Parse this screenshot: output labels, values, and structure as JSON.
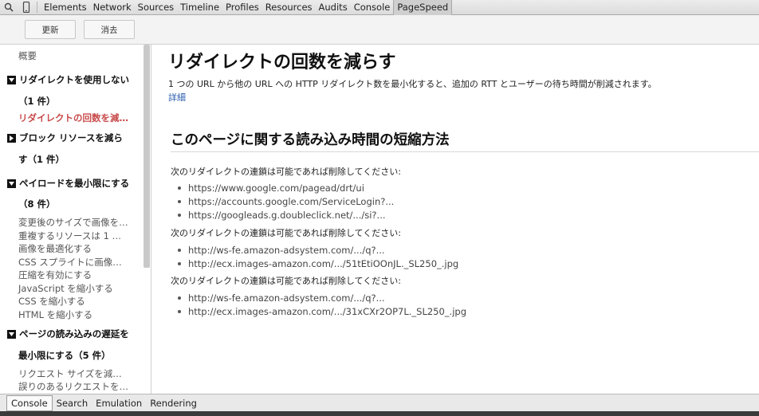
{
  "toolbar": {
    "tabs": [
      "Elements",
      "Network",
      "Sources",
      "Timeline",
      "Profiles",
      "Resources",
      "Audits",
      "Console",
      "PageSpeed"
    ]
  },
  "actions": {
    "refresh": "更新",
    "clear": "消去"
  },
  "sidebar": {
    "overview": "概要",
    "sections": [
      {
        "line1": "リダイレクトを使用しない",
        "line2": "（1 件）",
        "items": [
          "リダイレクトの回数を減…"
        ]
      },
      {
        "line1": "ブロック リソースを減ら",
        "line2": "す（1 件）",
        "items": []
      },
      {
        "line1": "ペイロードを最小限にする",
        "line2": "（8 件）",
        "items": [
          "変更後のサイズで画像を…",
          "重複するリソースは 1 …",
          "画像を最適化する",
          "CSS スプライトに画像…",
          "圧縮を有効にする",
          "JavaScript を縮小する",
          "CSS を縮小する",
          "HTML を縮小する"
        ]
      },
      {
        "line1": "ページの読み込みの遅延を",
        "line2": "最小限にする（5 件）",
        "items": [
          "リクエスト サイズを減…",
          "誤りのあるリクエストを…"
        ]
      }
    ]
  },
  "main": {
    "title": "リダイレクトの回数を減らす",
    "description": "1 つの URL から他の URL への HTTP リダイレクト数を最小化すると、追加の RTT とユーザーの待ち時間が削減されます。",
    "more_link": "詳細",
    "subheading": "このページに関する読み込み時間の短縮方法",
    "chains": [
      {
        "intro": "次のリダイレクトの連鎖は可能であれば削除してください:",
        "urls": [
          "https://www.google.com/pagead/drt/ui",
          "https://accounts.google.com/ServiceLogin?...",
          "https://googleads.g.doubleclick.net/.../si?..."
        ]
      },
      {
        "intro": "次のリダイレクトの連鎖は可能であれば削除してください:",
        "urls": [
          "http://ws-fe.amazon-adsystem.com/.../q?...",
          "http://ecx.images-amazon.com/.../51tEtiOOnJL._SL250_.jpg"
        ]
      },
      {
        "intro": "次のリダイレクトの連鎖は可能であれば削除してください:",
        "urls": [
          "http://ws-fe.amazon-adsystem.com/.../q?...",
          "http://ecx.images-amazon.com/.../31xCXr2OP7L._SL250_.jpg"
        ]
      }
    ]
  },
  "drawer": {
    "tabs": [
      "Console",
      "Search",
      "Emulation",
      "Rendering"
    ]
  }
}
